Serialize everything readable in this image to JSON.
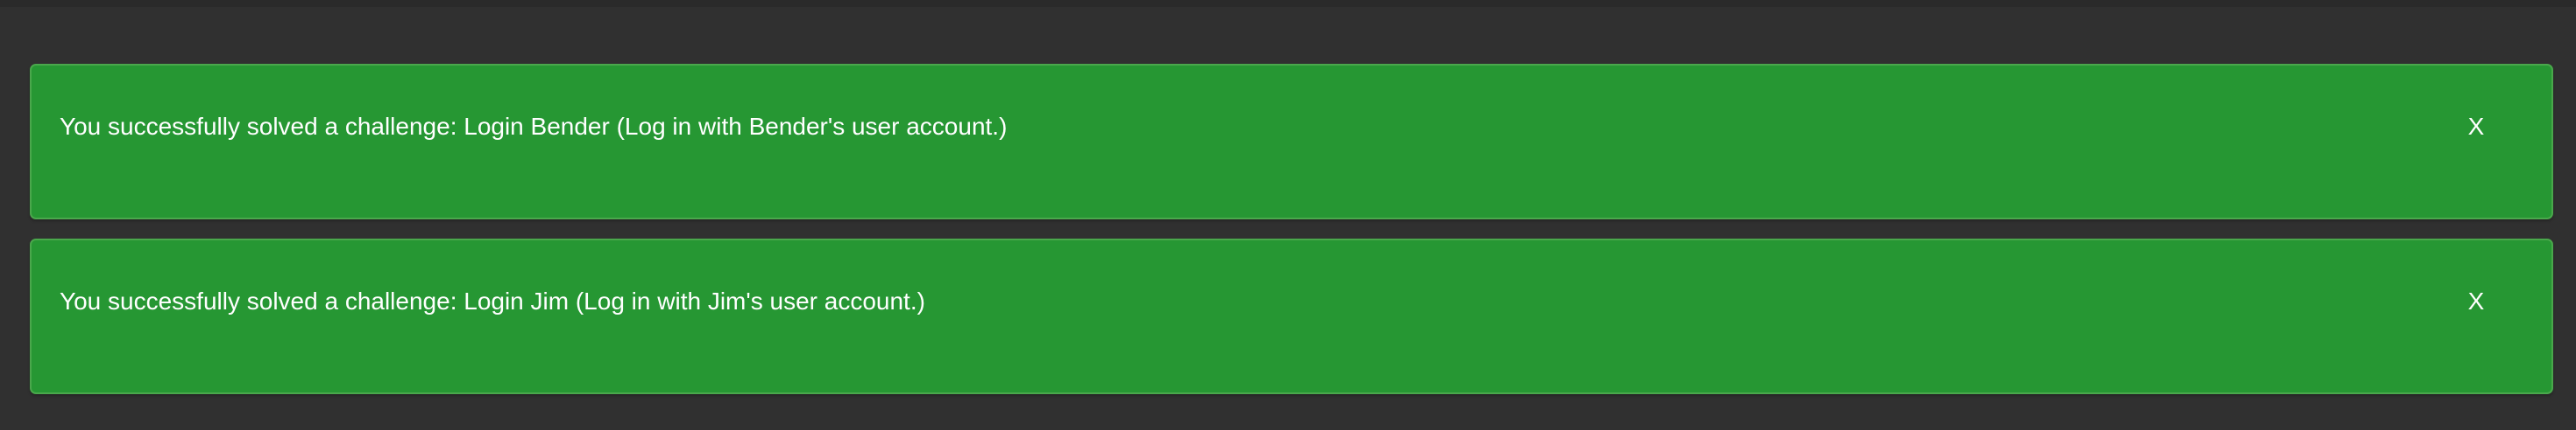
{
  "notifications": [
    {
      "message": "You successfully solved a challenge: Login Bender (Log in with Bender's user account.)",
      "dismiss_label": "X"
    },
    {
      "message": "You successfully solved a challenge: Login Jim (Log in with Jim's user account.)",
      "dismiss_label": "X"
    }
  ],
  "colors": {
    "background": "#303030",
    "success": "#269733",
    "text": "#ffffff"
  }
}
